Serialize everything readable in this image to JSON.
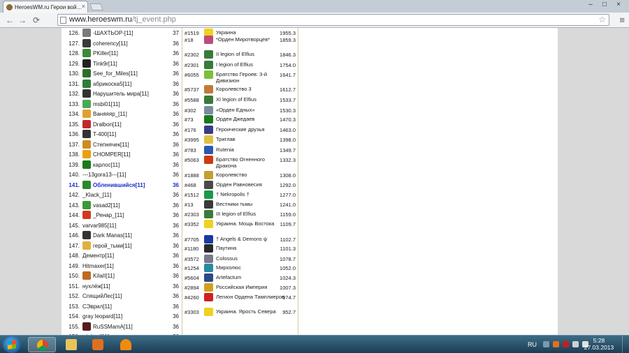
{
  "browser": {
    "tab_title": "HeroesWM.ru Герои вой…",
    "tab_close": "×",
    "url_host": "www.heroeswm.ru",
    "url_path": "/tj_event.php",
    "win_min": "–",
    "win_max": "□",
    "win_close": "×",
    "back": "←",
    "forward": "→",
    "reload": "⟳",
    "star": "☆",
    "menu": "≡"
  },
  "ranking": [
    {
      "num": "126.",
      "name": "-ШАХТЬОР-[11]",
      "level": "37",
      "color": "#7a7a7a"
    },
    {
      "num": "127.",
      "name": "coherency[11]",
      "level": "36",
      "color": "#3a3a3a"
    },
    {
      "num": "128.",
      "name": "PKiller[11]",
      "level": "36",
      "color": "#3f8a3a"
    },
    {
      "num": "129.",
      "name": "Tink9r[11]",
      "level": "36",
      "color": "#222222"
    },
    {
      "num": "130.",
      "name": "See_for_Miles[11]",
      "level": "36",
      "color": "#2d6e2d"
    },
    {
      "num": "131.",
      "name": "абрикоска5[11]",
      "level": "36",
      "color": "#2e7d3a"
    },
    {
      "num": "132.",
      "name": "Нарушитель мира[11]",
      "level": "36",
      "color": "#333333"
    },
    {
      "num": "133.",
      "name": "msbi01[11]",
      "level": "36",
      "color": "#4aa85a"
    },
    {
      "num": "134.",
      "name": "Ваняяяр_[11]",
      "level": "36",
      "color": "#e0a030"
    },
    {
      "num": "135.",
      "name": "Dralbon[11]",
      "level": "36",
      "color": "#c0282a"
    },
    {
      "num": "136.",
      "name": "T-400[11]",
      "level": "36",
      "color": "#333333"
    },
    {
      "num": "137.",
      "name": "Степнячек[11]",
      "level": "36",
      "color": "#d08a20"
    },
    {
      "num": "138.",
      "name": "CHOMPER[11]",
      "level": "36",
      "color": "#e8a010"
    },
    {
      "num": "139.",
      "name": "карлос[11]",
      "level": "36",
      "color": "#1a7a1a"
    },
    {
      "num": "140.",
      "name": "---13gora13---[11]",
      "level": "36",
      "color": ""
    },
    {
      "num": "141.",
      "name": "Обленившийся[11]",
      "level": "36",
      "color": "#2a8a2a",
      "highlight": true
    },
    {
      "num": "142.",
      "name": "_Klack_[11]",
      "level": "36",
      "color": ""
    },
    {
      "num": "143.",
      "name": "vasad2[11]",
      "level": "36",
      "color": "#3a9a3a"
    },
    {
      "num": "144.",
      "name": "_Ренар_[11]",
      "level": "36",
      "color": "#d03a20"
    },
    {
      "num": "145.",
      "name": "varvar985[11]",
      "level": "36",
      "color": ""
    },
    {
      "num": "146.",
      "name": "Dark Manas[11]",
      "level": "36",
      "color": "#333333"
    },
    {
      "num": "147.",
      "name": "герой_тьми[11]",
      "level": "36",
      "color": "#e0b040"
    },
    {
      "num": "148.",
      "name": "Дементр[11]",
      "level": "36",
      "color": ""
    },
    {
      "num": "149.",
      "name": "Hitmaxer[11]",
      "level": "36",
      "color": ""
    },
    {
      "num": "150.",
      "name": "KiIaII[11]",
      "level": "36",
      "color": "#c06a20"
    },
    {
      "num": "151.",
      "name": "нухлёж[11]",
      "level": "36",
      "color": ""
    },
    {
      "num": "152.",
      "name": "СпящийЛес[11]",
      "level": "36",
      "color": ""
    },
    {
      "num": "153.",
      "name": "СЭврил[11]",
      "level": "36",
      "color": ""
    },
    {
      "num": "154.",
      "name": "gray leopard[11]",
      "level": "36",
      "color": ""
    },
    {
      "num": "155.",
      "name": "RuSSMamA[11]",
      "level": "36",
      "color": "#5a1a1a"
    },
    {
      "num": "156.",
      "name": "winkart[11]",
      "level": "36",
      "color": ""
    },
    {
      "num": "157.",
      "name": "PreameR[11]",
      "level": "36",
      "color": ""
    }
  ],
  "clans": [
    {
      "id": "#1519",
      "name": "Украина",
      "score": "1955.3",
      "color": "#f0d020",
      "h": 10
    },
    {
      "id": "#18",
      "name": "*Орден Миротворцев*",
      "score": "1859.3",
      "color": "#c04a7a",
      "h": 22
    },
    {
      "id": "#2302",
      "name": "II legion of Elfius",
      "score": "1846.3",
      "color": "#3a7a3a",
      "h": 15
    },
    {
      "id": "#2301",
      "name": "I legion of Elfius",
      "score": "1754.0",
      "color": "#3a7a3a",
      "h": 15
    },
    {
      "id": "#6055",
      "name": "Братство Героев: 3-й Дивизион",
      "score": "1641.7",
      "color": "#7ac03a",
      "h": 22
    },
    {
      "id": "#5737",
      "name": "Королевство 3",
      "score": "1612.7",
      "color": "#c07a3a",
      "h": 15
    },
    {
      "id": "#5588",
      "name": "XI legion of Elfius",
      "score": "1533.7",
      "color": "#3a7a3a",
      "h": 15
    },
    {
      "id": "#302",
      "name": "«Орден Едных»",
      "score": "1530.3",
      "color": "#7a8aa0",
      "h": 14
    },
    {
      "id": "#73",
      "name": "Орден Джедаев",
      "score": "1470.3",
      "color": "#1a7a1a",
      "h": 15
    },
    {
      "id": "#176",
      "name": "Героические друзья",
      "score": "1463.0",
      "color": "#3a3a8a",
      "h": 15
    },
    {
      "id": "#3995",
      "name": "Триглав",
      "score": "1398.0",
      "color": "#e0c040",
      "h": 15
    },
    {
      "id": "#783",
      "name": "Rutenia",
      "score": "1349.7",
      "color": "#2a5ab0",
      "h": 15
    },
    {
      "id": "#5063",
      "name": "Братство Огненного Дракона",
      "score": "1332.3",
      "color": "#d03a10",
      "h": 22
    },
    {
      "id": "#1888",
      "name": "Королевство",
      "score": "1308.0",
      "color": "#c0a030",
      "h": 15
    },
    {
      "id": "#468",
      "name": "Орден Равновесия",
      "score": "1292.0",
      "color": "#4a4a4a",
      "h": 14
    },
    {
      "id": "#1512",
      "name": "† Nekropolis †",
      "score": "1277.0",
      "color": "#1a9a4a",
      "h": 15
    },
    {
      "id": "#13",
      "name": "Вестники тьмы",
      "score": "1241.0",
      "color": "#3a3a3a",
      "h": 14
    },
    {
      "id": "#2303",
      "name": "III legion of Elfius",
      "score": "1159.0",
      "color": "#3a7a3a",
      "h": 15
    },
    {
      "id": "#3352",
      "name": "Украина. Мощь Востока",
      "score": "1109.7",
      "color": "#f0d020",
      "h": 22
    },
    {
      "id": "#7705",
      "name": "† Angels & Demons ψ",
      "score": "1102.7",
      "color": "#1a3aa0",
      "h": 14
    },
    {
      "id": "#1180",
      "name": "Паутина",
      "score": "1101.3",
      "color": "#2a2a2a",
      "h": 15
    },
    {
      "id": "#3572",
      "name": "Colossus",
      "score": "1078.7",
      "color": "#7a7a8a",
      "h": 14
    },
    {
      "id": "#1254",
      "name": "Мирхолюс",
      "score": "1052.0",
      "color": "#2a8aa0",
      "h": 14
    },
    {
      "id": "#5604",
      "name": "Artefactum",
      "score": "1024.3",
      "color": "#2a4a8a",
      "h": 14
    },
    {
      "id": "#2894",
      "name": "Российская Империя",
      "score": "1007.3",
      "color": "#d0a020",
      "h": 15
    },
    {
      "id": "#4260",
      "name": "Легион Ордена Тамплиеров",
      "score": "974.7",
      "color": "#d02020",
      "h": 22
    },
    {
      "id": "#3303",
      "name": "Украина. Ярость Севера",
      "score": "952.7",
      "color": "#f0d020",
      "h": 22
    }
  ],
  "tray": {
    "lang": "RU",
    "time": "5:28",
    "date": "27.03.2013"
  }
}
